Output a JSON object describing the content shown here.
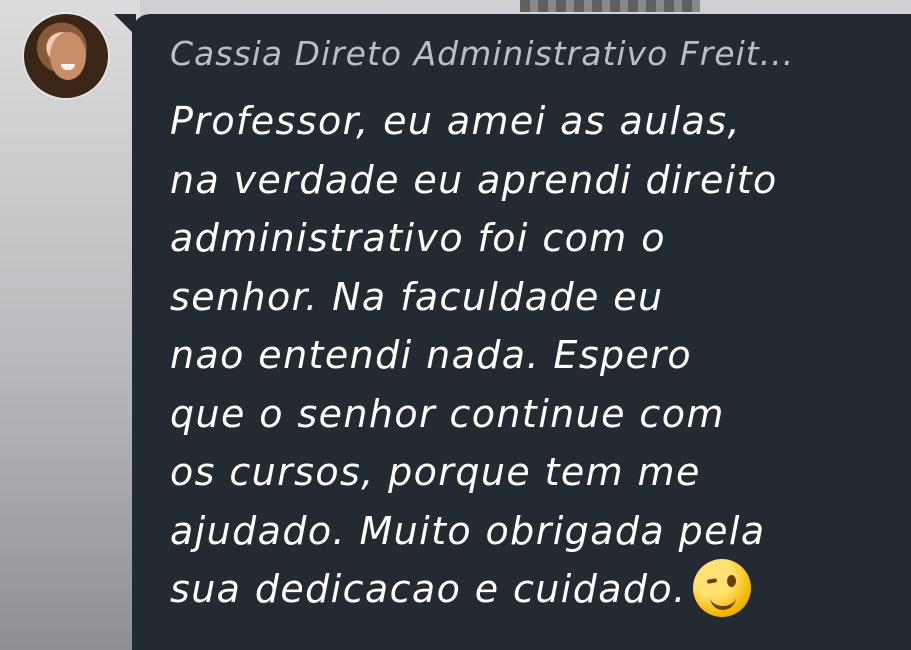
{
  "chat": {
    "sender_name": "Cassia Direto Administrativo Freit...",
    "message_lines": [
      "Professor, eu amei as aulas,",
      "na verdade eu aprendi direito",
      "administrativo foi com o",
      "senhor. Na faculdade eu",
      "nao entendi nada. Espero",
      "que o senhor continue com",
      "os cursos, porque tem me",
      "ajudado. Muito obrigada pela",
      "sua dedicacao e cuidado."
    ],
    "emoji": "winking-face-emoji"
  },
  "colors": {
    "bubble_bg": "#242a31",
    "sender_text": "#b8bfc6",
    "message_text": "#ffffff"
  }
}
